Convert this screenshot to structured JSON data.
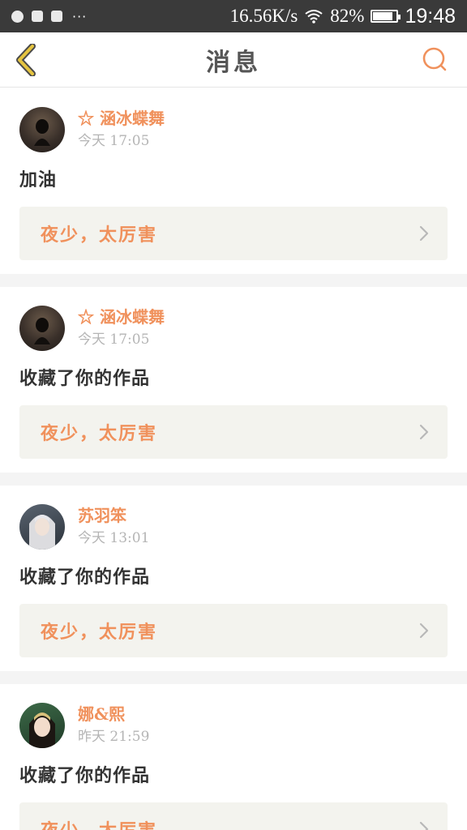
{
  "status_bar": {
    "dots": "···",
    "net_speed": "16.56K/s",
    "battery": "82%",
    "battery_level": 0.82,
    "time": "19:48"
  },
  "nav": {
    "title": "消息",
    "back_icon": "chevron-left-icon",
    "search_icon": "search-icon",
    "accent_color": "#f0915c",
    "back_color": "#e5c440"
  },
  "notifications": [
    {
      "username": "☆ 涵冰蝶舞",
      "time": "今天 17:05",
      "message": "加油",
      "work_title": "夜少，太厉害"
    },
    {
      "username": "☆ 涵冰蝶舞",
      "time": "今天 17:05",
      "message": "收藏了你的作品",
      "work_title": "夜少，太厉害"
    },
    {
      "username": "苏羽笨",
      "time": "今天 13:01",
      "message": "收藏了你的作品",
      "work_title": "夜少，太厉害"
    },
    {
      "username": "娜&熙",
      "time": "昨天 21:59",
      "message": "收藏了你的作品",
      "work_title": "夜少，太厉害"
    }
  ]
}
